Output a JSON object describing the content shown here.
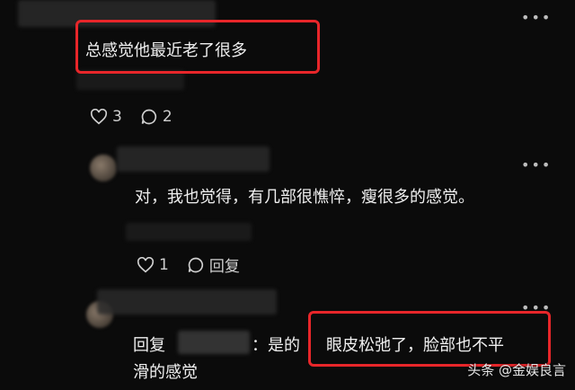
{
  "comments": [
    {
      "text": "总感觉他最近老了很多",
      "likes": "3",
      "replies": "2",
      "more_icon": "more-dots-icon"
    },
    {
      "text": "对，我也觉得，有几部很憔悴，瘦很多的感觉。",
      "likes": "1",
      "reply_label": "回复",
      "more_icon": "more-dots-icon"
    },
    {
      "reply_prefix": "回复",
      "reply_suffix": "：是的",
      "line1_highlight": "眼皮松弛了，脸部也不平",
      "line2": "滑的感觉",
      "more_icon": "more-dots-icon"
    }
  ],
  "watermark": "头条 @金娱良言",
  "colors": {
    "highlight_box": "#e8262a",
    "background": "#0b0b0b"
  }
}
